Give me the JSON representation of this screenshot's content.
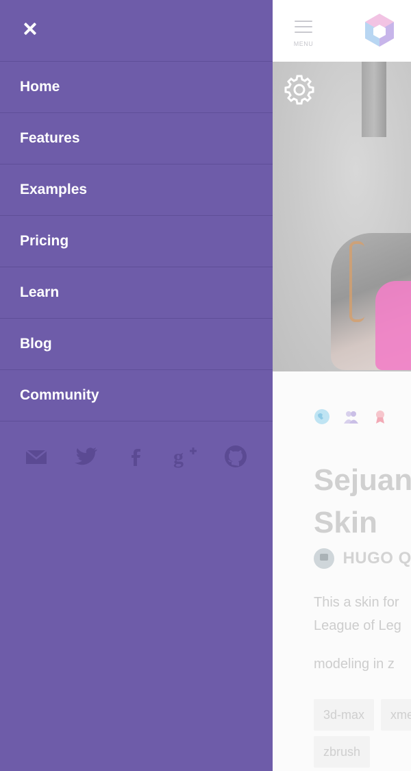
{
  "drawer": {
    "close_icon": "close-icon",
    "items": [
      {
        "label": "Home"
      },
      {
        "label": "Features"
      },
      {
        "label": "Examples"
      },
      {
        "label": "Pricing"
      },
      {
        "label": "Learn"
      },
      {
        "label": "Blog"
      },
      {
        "label": "Community"
      }
    ],
    "socials": [
      "mail-icon",
      "twitter-icon",
      "facebook-icon",
      "google-plus-icon",
      "github-icon"
    ]
  },
  "header": {
    "menu_label": "MENU",
    "logo_icon": "cube-logo-icon"
  },
  "hero": {
    "settings_icon": "gear-icon"
  },
  "content": {
    "meta_icons": [
      "globe-icon",
      "users-icon",
      "award-icon"
    ],
    "title_line1": "Sejuan",
    "title_line2": "Skin",
    "author": "HUGO Q",
    "description_line1": "This a skin for",
    "description_line2": "League of Leg",
    "description_line3": "modeling in z",
    "tags": [
      "3d-max",
      "xme",
      "zbrush"
    ]
  },
  "colors": {
    "drawer_bg": "#6e5ca9",
    "drawer_divider": "#5f4e98",
    "accent_pink": "#f17fc6"
  }
}
